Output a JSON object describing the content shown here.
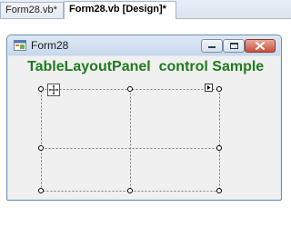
{
  "tabs": [
    {
      "label": "Form28.vb*"
    },
    {
      "label": "Form28.vb [Design]*"
    }
  ],
  "form": {
    "title": "Form28",
    "heading": "TableLayoutPanel  control Sample",
    "heading_color": "#1f7a1f"
  },
  "caption_buttons": [
    {
      "icon": "minimize-icon"
    },
    {
      "icon": "maximize-icon"
    },
    {
      "icon": "close-icon"
    }
  ],
  "table_layout_panel": {
    "columns": 2,
    "rows": 2,
    "icons": [
      "move-icon",
      "smart-tag-icon"
    ]
  }
}
